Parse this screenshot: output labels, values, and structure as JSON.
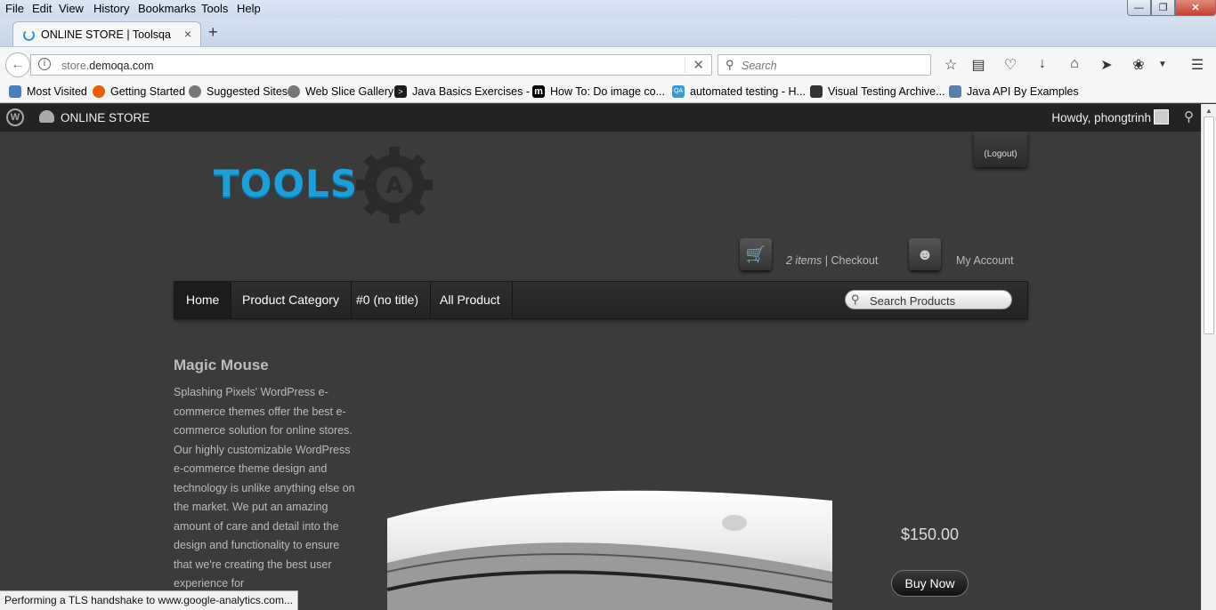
{
  "menubar": {
    "items": [
      "File",
      "Edit",
      "View",
      "History",
      "Bookmarks",
      "Tools",
      "Help"
    ]
  },
  "window_controls": {
    "minimize": "—",
    "maximize": "❐",
    "close": "✕"
  },
  "tab": {
    "title": "ONLINE STORE | Toolsqa Dummy",
    "close": "×",
    "new_tab": "+"
  },
  "navbar": {
    "url_host_prefix": "store.",
    "url_host": "demoqa.com",
    "search_placeholder": "Search"
  },
  "bookmarks": [
    {
      "label": "Most Visited",
      "icon": "most-visited-icon",
      "color": "#4a7cc1"
    },
    {
      "label": "Getting Started",
      "icon": "firefox-icon",
      "color": "#e66000"
    },
    {
      "label": "Suggested Sites",
      "icon": "globe-icon",
      "color": "#777777"
    },
    {
      "label": "Web Slice Gallery",
      "icon": "globe-icon",
      "color": "#777777"
    },
    {
      "label": "Java Basics Exercises - ...",
      "icon": "terminal-icon",
      "color": "#1c1c1c"
    },
    {
      "label": "How To: Do image co...",
      "icon": "m-icon",
      "color": "#000000"
    },
    {
      "label": "automated testing - H...",
      "icon": "qa-icon",
      "color": "#3d9ad1"
    },
    {
      "label": "Visual Testing Archive...",
      "icon": "graduation-cap-icon",
      "color": "#333333"
    },
    {
      "label": "Java API By Examples",
      "icon": "java-icon",
      "color": "#5b7fa8"
    }
  ],
  "wpbar": {
    "site_name": "ONLINE STORE",
    "howdy": "Howdy, phongtrinh"
  },
  "header": {
    "logo_text": "TOOLS",
    "logout": "(Logout)",
    "cart_items": "2 items",
    "cart_separator": " | ",
    "checkout": "Checkout",
    "my_account": "My Account"
  },
  "nav": {
    "items": [
      "Home",
      "Product Category",
      "#0 (no title)",
      "All Product"
    ],
    "search_placeholder": "Search Products"
  },
  "product": {
    "title": "Magic Mouse",
    "description": "Splashing Pixels' WordPress e-commerce themes offer the best e-commerce solution for online stores. Our highly customizable WordPress e-commerce theme design and technology is unlike anything else on the market. We put an amazing amount of care and detail into the design and functionality to ensure that we're creating the best user experience for",
    "price": "$150.00",
    "buy_label": "Buy Now"
  },
  "status_text": "Performing a TLS handshake to www.google-analytics.com...",
  "colors": {
    "logo_blue": "#1d9fd8",
    "page_bg": "#3b3b3b",
    "admin_bar": "#232323"
  }
}
